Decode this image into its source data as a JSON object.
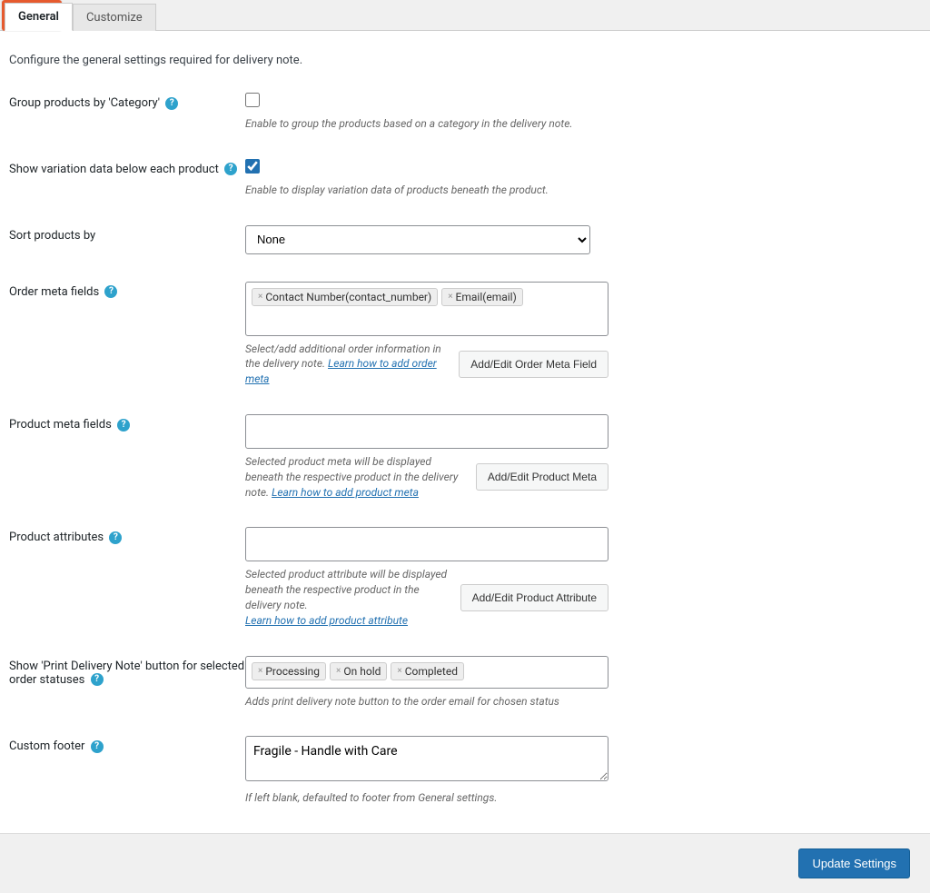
{
  "tabs": {
    "general": "General",
    "customize": "Customize"
  },
  "intro": "Configure the general settings required for delivery note.",
  "rows": {
    "group_category": {
      "label": "Group products by 'Category'",
      "checked": false,
      "desc": "Enable to group the products based on a category in the delivery note."
    },
    "variation": {
      "label": "Show variation data below each product",
      "checked": true,
      "desc": "Enable to display variation data of products beneath the product."
    },
    "sort": {
      "label": "Sort products by",
      "value": "None"
    },
    "order_meta": {
      "label": "Order meta fields",
      "tags": [
        "Contact Number(contact_number)",
        "Email(email)"
      ],
      "desc": "Select/add additional order information in the delivery note.",
      "link": "Learn how to add order meta",
      "button": "Add/Edit Order Meta Field"
    },
    "product_meta": {
      "label": "Product meta fields",
      "desc": "Selected product meta will be displayed beneath the respective product in the delivery note.",
      "link": "Learn how to add product meta",
      "button": "Add/Edit Product Meta"
    },
    "product_attr": {
      "label": "Product attributes",
      "desc": "Selected product attribute will be displayed beneath the respective product in the delivery note.",
      "link": "Learn how to add product attribute",
      "button": "Add/Edit Product Attribute"
    },
    "print_button": {
      "label": "Show 'Print Delivery Note' button for selected order statuses",
      "tags": [
        "Processing",
        "On hold",
        "Completed"
      ],
      "desc": "Adds print delivery note button to the order email for chosen status"
    },
    "footer": {
      "label": "Custom footer",
      "value": "Fragile - Handle with Care",
      "desc": "If left blank, defaulted to footer from General settings."
    }
  },
  "update_button": "Update Settings"
}
